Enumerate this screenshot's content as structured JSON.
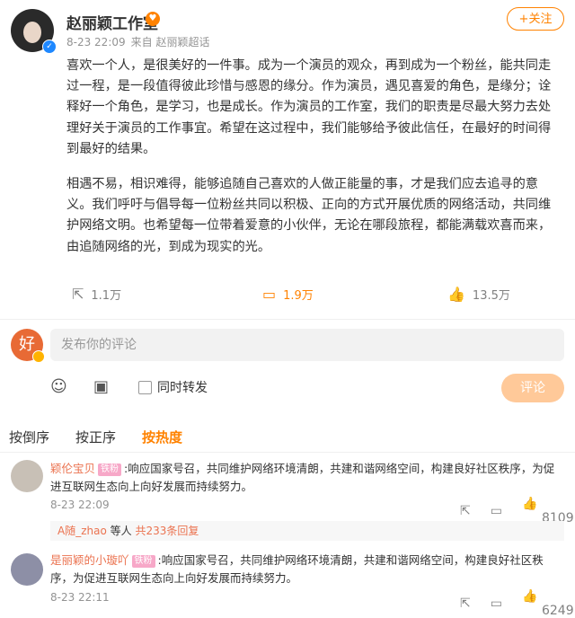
{
  "post": {
    "author": "赵丽颖工作室",
    "time": "8-23 22:09",
    "source": "来自 赵丽颖超话",
    "follow_label": "+关注",
    "paragraphs": [
      "喜欢一个人，是很美好的一件事。成为一个演员的观众，再到成为一个粉丝，能共同走过一程，是一段值得彼此珍惜与感恩的缘分。作为演员，遇见喜爱的角色，是缘分；诠释好一个角色，是学习，也是成长。作为演员的工作室，我们的职责是尽最大努力去处理好关于演员的工作事宜。希望在这过程中，我们能够给予彼此信任，在最好的时间得到最好的结果。",
      "相遇不易，相识难得，能够追随自己喜欢的人做正能量的事，才是我们应去追寻的意义。我们呼吁与倡导每一位粉丝共同以积极、正向的方式开展优质的网络活动，共同维护网络文明。也希望每一位带着爱意的小伙伴，无论在哪段旅程，都能满载欢喜而来，由追随网络的光，到成为现实的光。"
    ],
    "reposts": "1.1万",
    "comments": "1.9万",
    "likes": "13.5万"
  },
  "composer": {
    "placeholder": "发布你的评论",
    "repost_label": "同时转发",
    "submit_label": "评论"
  },
  "sort": {
    "reverse": "按倒序",
    "forward": "按正序",
    "hot": "按热度"
  },
  "comments": [
    {
      "user": "颖伦宝贝",
      "badge": "铁粉",
      "text": ":响应国家号召，共同维护网络环境清朗，共建和谐网络空间，构建良好社区秩序，为促进互联网生态向上向好发展而持续努力。",
      "time": "8-23 22:09",
      "likes": "8109",
      "reply_user": "A随_zhao",
      "reply_mid": " 等人 ",
      "reply_more": "共233条回复"
    },
    {
      "user": "是丽颖的小璇吖",
      "badge": "铁粉",
      "text": ":响应国家号召，共同维护网络环境清朗，共建和谐网络空间，构建良好社区秩序，为促进互联网生态向上向好发展而持续努力。",
      "time": "8-23 22:11",
      "likes": "6249"
    }
  ],
  "icons": {
    "verified": "verified-badge-icon",
    "flame": "fan-level-icon",
    "repost": "repost-icon",
    "comment": "comment-icon",
    "like": "like-icon",
    "emoji": "emoji-icon",
    "image": "image-icon",
    "share": "share-icon"
  },
  "colors": {
    "accent": "#ff8200",
    "username": "#eb7350",
    "submit_disabled": "#ffc999"
  }
}
